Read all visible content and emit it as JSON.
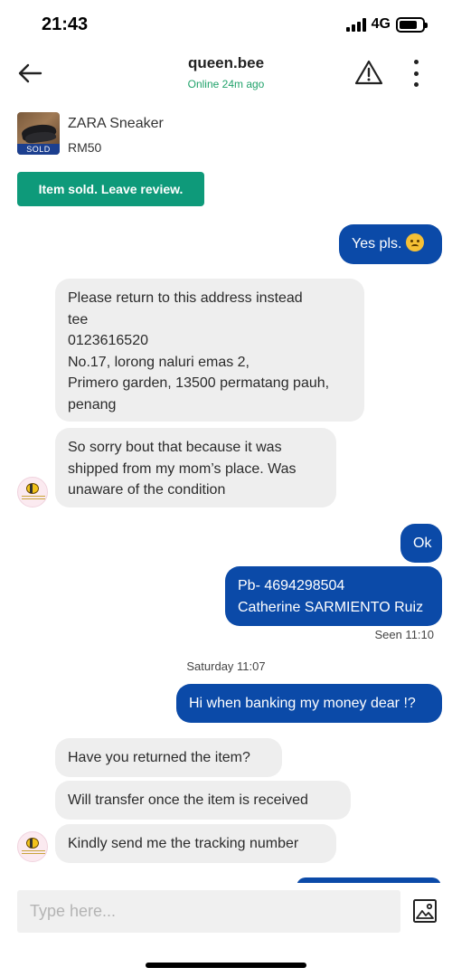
{
  "status_bar": {
    "time": "21:43",
    "network": "4G"
  },
  "header": {
    "contact_name": "queen.bee",
    "online_status": "Online 24m ago",
    "icons": [
      "back-arrow-icon",
      "warning-icon",
      "more-vertical-icon"
    ]
  },
  "item": {
    "title": "ZARA Sneaker",
    "price": "RM50",
    "badge": "SOLD"
  },
  "review_button": "Item sold. Leave review.",
  "messages": [
    {
      "from": "me",
      "text": "Yes pls."
    },
    {
      "from": "them",
      "text": "Please return to this address instead\ntee\n0123616520\nNo.17, lorong naluri emas 2,\nPrimero garden, 13500 permatang pauh,\npenang"
    },
    {
      "from": "them",
      "text": "So sorry bout that because it was\nshipped from my mom’s place. Was\nunaware of the condition"
    },
    {
      "from": "me",
      "text": "Ok"
    },
    {
      "from": "me",
      "text": "Pb- 4694298504\nCatherine SARMIENTO Ruiz"
    },
    {
      "from": "me",
      "text": "Hi when banking my money dear !?"
    },
    {
      "from": "them",
      "text": "Have you returned the item?"
    },
    {
      "from": "them",
      "text": "Will transfer once the item is received"
    },
    {
      "from": "them",
      "text": "Kindly send me the tracking number"
    }
  ],
  "seen_label": "Seen 11:10",
  "date_separator": "Saturday 11:07",
  "composer": {
    "placeholder": "Type here..."
  },
  "colors": {
    "outgoing_bubble": "#0b4aa8",
    "incoming_bubble": "#eeeeee",
    "review_button": "#0e9a7a",
    "online": "#20a26a"
  }
}
